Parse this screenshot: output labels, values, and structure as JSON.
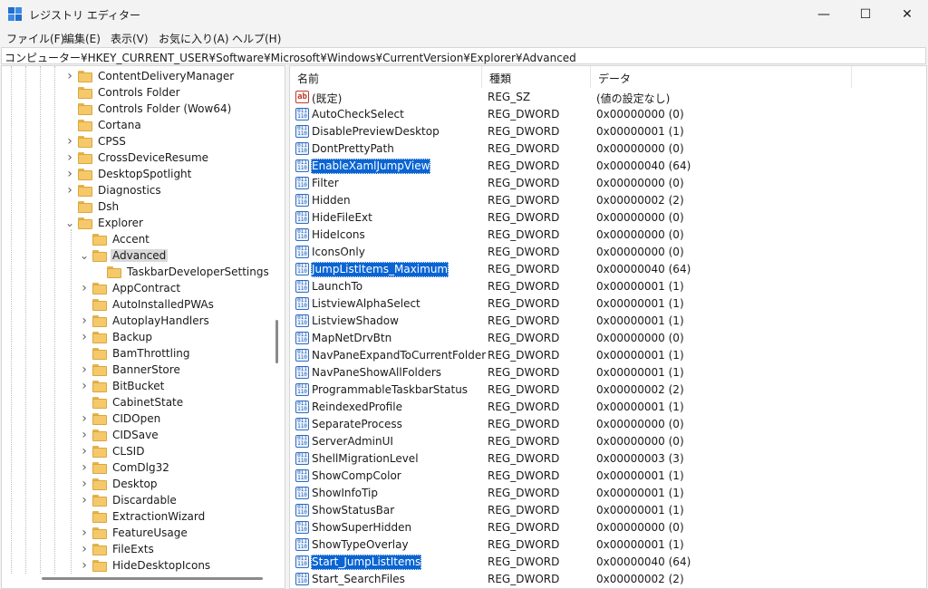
{
  "window": {
    "title": "レジストリ エディター",
    "buttons": [
      "—",
      "☐",
      "✕"
    ]
  },
  "menu": [
    "ファイル(F)",
    "編集(E)",
    "表示(V)",
    "お気に入り(A)",
    "ヘルプ(H)"
  ],
  "address": "コンピューター¥HKEY_CURRENT_USER¥Software¥Microsoft¥Windows¥CurrentVersion¥Explorer¥Advanced",
  "tree": [
    {
      "label": "ContentDeliveryManager",
      "level": 0,
      "chevron": "right"
    },
    {
      "label": "Controls Folder",
      "level": 0,
      "chevron": "none"
    },
    {
      "label": "Controls Folder (Wow64)",
      "level": 0,
      "chevron": "none"
    },
    {
      "label": "Cortana",
      "level": 0,
      "chevron": "none"
    },
    {
      "label": "CPSS",
      "level": 0,
      "chevron": "right"
    },
    {
      "label": "CrossDeviceResume",
      "level": 0,
      "chevron": "right"
    },
    {
      "label": "DesktopSpotlight",
      "level": 0,
      "chevron": "right"
    },
    {
      "label": "Diagnostics",
      "level": 0,
      "chevron": "right"
    },
    {
      "label": "Dsh",
      "level": 0,
      "chevron": "none"
    },
    {
      "label": "Explorer",
      "level": 0,
      "chevron": "down"
    },
    {
      "label": "Accent",
      "level": 1,
      "chevron": "none"
    },
    {
      "label": "Advanced",
      "level": 1,
      "chevron": "down",
      "selected": true
    },
    {
      "label": "TaskbarDeveloperSettings",
      "level": 2,
      "chevron": "none"
    },
    {
      "label": "AppContract",
      "level": 1,
      "chevron": "right"
    },
    {
      "label": "AutoInstalledPWAs",
      "level": 1,
      "chevron": "none"
    },
    {
      "label": "AutoplayHandlers",
      "level": 1,
      "chevron": "right"
    },
    {
      "label": "Backup",
      "level": 1,
      "chevron": "right"
    },
    {
      "label": "BamThrottling",
      "level": 1,
      "chevron": "none"
    },
    {
      "label": "BannerStore",
      "level": 1,
      "chevron": "right"
    },
    {
      "label": "BitBucket",
      "level": 1,
      "chevron": "right"
    },
    {
      "label": "CabinetState",
      "level": 1,
      "chevron": "none"
    },
    {
      "label": "CIDOpen",
      "level": 1,
      "chevron": "right"
    },
    {
      "label": "CIDSave",
      "level": 1,
      "chevron": "right"
    },
    {
      "label": "CLSID",
      "level": 1,
      "chevron": "right"
    },
    {
      "label": "ComDlg32",
      "level": 1,
      "chevron": "right"
    },
    {
      "label": "Desktop",
      "level": 1,
      "chevron": "right"
    },
    {
      "label": "Discardable",
      "level": 1,
      "chevron": "right"
    },
    {
      "label": "ExtractionWizard",
      "level": 1,
      "chevron": "none"
    },
    {
      "label": "FeatureUsage",
      "level": 1,
      "chevron": "right"
    },
    {
      "label": "FileExts",
      "level": 1,
      "chevron": "right"
    },
    {
      "label": "HideDesktopIcons",
      "level": 1,
      "chevron": "right"
    }
  ],
  "columns": [
    "名前",
    "種類",
    "データ"
  ],
  "values": [
    {
      "name": "(既定)",
      "type": "REG_SZ",
      "data": "(値の設定なし)",
      "icon": "string-value-icon"
    },
    {
      "name": "AutoCheckSelect",
      "type": "REG_DWORD",
      "data": "0x00000000 (0)",
      "icon": "binary-value-icon"
    },
    {
      "name": "DisablePreviewDesktop",
      "type": "REG_DWORD",
      "data": "0x00000001 (1)",
      "icon": "binary-value-icon"
    },
    {
      "name": "DontPrettyPath",
      "type": "REG_DWORD",
      "data": "0x00000000 (0)",
      "icon": "binary-value-icon"
    },
    {
      "name": "EnableXamlJumpView",
      "type": "REG_DWORD",
      "data": "0x00000040 (64)",
      "icon": "binary-value-icon",
      "selected": true
    },
    {
      "name": "Filter",
      "type": "REG_DWORD",
      "data": "0x00000000 (0)",
      "icon": "binary-value-icon"
    },
    {
      "name": "Hidden",
      "type": "REG_DWORD",
      "data": "0x00000002 (2)",
      "icon": "binary-value-icon"
    },
    {
      "name": "HideFileExt",
      "type": "REG_DWORD",
      "data": "0x00000000 (0)",
      "icon": "binary-value-icon"
    },
    {
      "name": "HideIcons",
      "type": "REG_DWORD",
      "data": "0x00000000 (0)",
      "icon": "binary-value-icon"
    },
    {
      "name": "IconsOnly",
      "type": "REG_DWORD",
      "data": "0x00000000 (0)",
      "icon": "binary-value-icon"
    },
    {
      "name": "JumpListItems_Maximum",
      "type": "REG_DWORD",
      "data": "0x00000040 (64)",
      "icon": "binary-value-icon",
      "selected": true
    },
    {
      "name": "LaunchTo",
      "type": "REG_DWORD",
      "data": "0x00000001 (1)",
      "icon": "binary-value-icon"
    },
    {
      "name": "ListviewAlphaSelect",
      "type": "REG_DWORD",
      "data": "0x00000001 (1)",
      "icon": "binary-value-icon"
    },
    {
      "name": "ListviewShadow",
      "type": "REG_DWORD",
      "data": "0x00000001 (1)",
      "icon": "binary-value-icon"
    },
    {
      "name": "MapNetDrvBtn",
      "type": "REG_DWORD",
      "data": "0x00000000 (0)",
      "icon": "binary-value-icon"
    },
    {
      "name": "NavPaneExpandToCurrentFolder",
      "type": "REG_DWORD",
      "data": "0x00000001 (1)",
      "icon": "binary-value-icon"
    },
    {
      "name": "NavPaneShowAllFolders",
      "type": "REG_DWORD",
      "data": "0x00000001 (1)",
      "icon": "binary-value-icon"
    },
    {
      "name": "ProgrammableTaskbarStatus",
      "type": "REG_DWORD",
      "data": "0x00000002 (2)",
      "icon": "binary-value-icon"
    },
    {
      "name": "ReindexedProfile",
      "type": "REG_DWORD",
      "data": "0x00000001 (1)",
      "icon": "binary-value-icon"
    },
    {
      "name": "SeparateProcess",
      "type": "REG_DWORD",
      "data": "0x00000000 (0)",
      "icon": "binary-value-icon"
    },
    {
      "name": "ServerAdminUI",
      "type": "REG_DWORD",
      "data": "0x00000000 (0)",
      "icon": "binary-value-icon"
    },
    {
      "name": "ShellMigrationLevel",
      "type": "REG_DWORD",
      "data": "0x00000003 (3)",
      "icon": "binary-value-icon"
    },
    {
      "name": "ShowCompColor",
      "type": "REG_DWORD",
      "data": "0x00000001 (1)",
      "icon": "binary-value-icon"
    },
    {
      "name": "ShowInfoTip",
      "type": "REG_DWORD",
      "data": "0x00000001 (1)",
      "icon": "binary-value-icon"
    },
    {
      "name": "ShowStatusBar",
      "type": "REG_DWORD",
      "data": "0x00000001 (1)",
      "icon": "binary-value-icon"
    },
    {
      "name": "ShowSuperHidden",
      "type": "REG_DWORD",
      "data": "0x00000000 (0)",
      "icon": "binary-value-icon"
    },
    {
      "name": "ShowTypeOverlay",
      "type": "REG_DWORD",
      "data": "0x00000001 (1)",
      "icon": "binary-value-icon"
    },
    {
      "name": "Start_JumpListItems",
      "type": "REG_DWORD",
      "data": "0x00000040 (64)",
      "icon": "binary-value-icon",
      "selected": true
    },
    {
      "name": "Start_SearchFiles",
      "type": "REG_DWORD",
      "data": "0x00000002 (2)",
      "icon": "binary-value-icon"
    }
  ],
  "colors": {
    "selection": "#0a64d2",
    "tree_selection": "#d9d9d9",
    "folder": "#f5c96a",
    "app_icon": "#1e6fd0"
  }
}
